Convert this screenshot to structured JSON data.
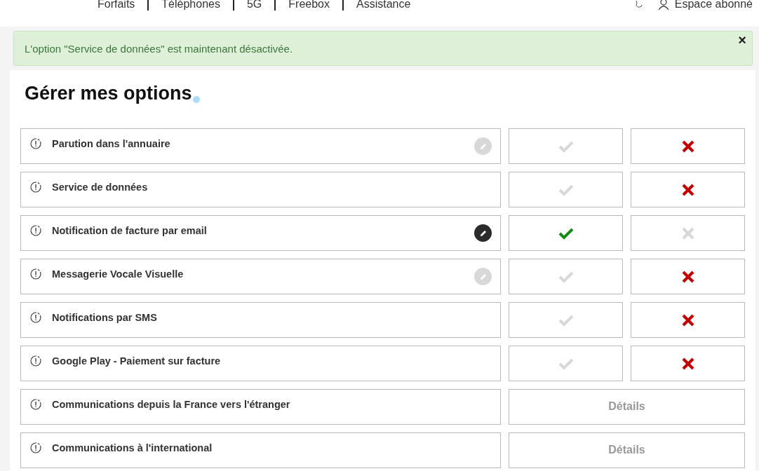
{
  "nav": {
    "items": [
      "Forfaits",
      "Téléphones",
      "5G",
      "Freebox",
      "Assistance"
    ],
    "account": "Espace abonné"
  },
  "alert": {
    "message": "L'option \"Service de données\" est maintenant désactivée.",
    "close": "×"
  },
  "title": "Gérer **mes options**",
  "options": [
    {
      "kind": "toggle",
      "label": "Parution dans l'annuaire",
      "edit_button": {
        "disabled": true
      },
      "on": false
    },
    {
      "kind": "toggle",
      "label": "Service de données",
      "on": false
    },
    {
      "kind": "toggle",
      "label": "Notification de facture par email",
      "edit_button": {
        "disabled": false
      },
      "on": true
    },
    {
      "kind": "toggle",
      "label": "Messagerie Vocale Visuelle",
      "edit_button": {
        "disabled": true
      },
      "on": false
    },
    {
      "kind": "toggle",
      "label": "Notifications par SMS",
      "on": false
    },
    {
      "kind": "toggle",
      "label": "Google Play - Paiement sur facture",
      "on": false
    },
    {
      "kind": "details",
      "label": "Communications depuis la France vers l'étranger",
      "button": "Détails"
    },
    {
      "kind": "details",
      "label": "Communications à l'international",
      "button": "Détails"
    }
  ]
}
